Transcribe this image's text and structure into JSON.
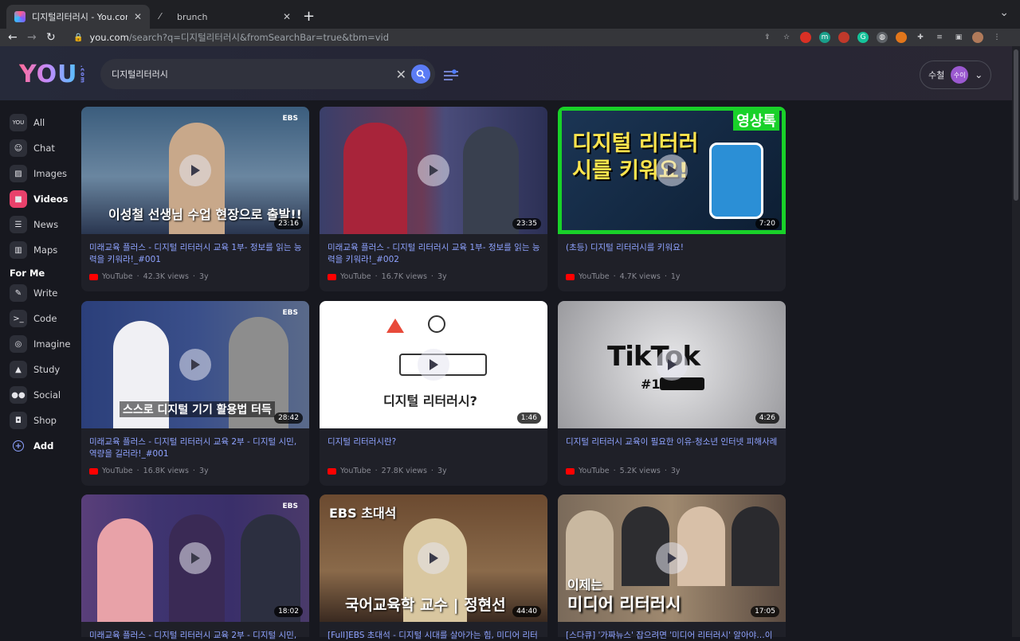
{
  "browser": {
    "tabs": [
      {
        "title": "디지털리터러시 - You.com | The A",
        "active": true
      },
      {
        "title": "brunch",
        "active": false
      }
    ],
    "url_host": "you.com",
    "url_path": "/search?q=디지털리터러시&fromSearchBar=true&tbm=vid"
  },
  "app": {
    "logo": "YOU",
    "logo_suffix": ".com",
    "search_query": "디지털리터러시",
    "user_name": "수철",
    "avatar_text": "수이"
  },
  "sidebar": {
    "items": [
      {
        "label": "All",
        "icon": "you-icon"
      },
      {
        "label": "Chat",
        "icon": "chat-icon"
      },
      {
        "label": "Images",
        "icon": "image-icon"
      },
      {
        "label": "Videos",
        "icon": "video-icon",
        "active": true
      },
      {
        "label": "News",
        "icon": "news-icon"
      },
      {
        "label": "Maps",
        "icon": "map-icon"
      }
    ],
    "section_label": "For Me",
    "me_items": [
      {
        "label": "Write",
        "icon": "pencil-icon"
      },
      {
        "label": "Code",
        "icon": "terminal-icon"
      },
      {
        "label": "Imagine",
        "icon": "spiral-icon"
      },
      {
        "label": "Study",
        "icon": "graduation-cap-icon"
      },
      {
        "label": "Social",
        "icon": "people-icon"
      },
      {
        "label": "Shop",
        "icon": "bag-icon"
      }
    ],
    "add_label": "Add"
  },
  "videos": [
    {
      "title": "미래교육 플러스 - 디지털 리터러시 교육 1부- 정보를 읽는 능력을 키워라!_#001",
      "source": "YouTube",
      "views": "42.3K views",
      "age": "3y",
      "duration": "23:16",
      "thumb_caption": "이성철 선생님 수업 현장으로 출발!!",
      "thumb_badge": "EBS"
    },
    {
      "title": "미래교육 플러스 - 디지털 리터러시 교육 1부- 정보를 읽는 능력을 키워라!_#002",
      "source": "YouTube",
      "views": "16.7K views",
      "age": "3y",
      "duration": "23:35",
      "thumb_caption": "",
      "thumb_badge": ""
    },
    {
      "title": "(초등) 디지털 리터러시를 키워요!",
      "source": "YouTube",
      "views": "4.7K views",
      "age": "1y",
      "duration": "7:20",
      "thumb_caption": "디지털 리터러시를 키워요!",
      "thumb_badge": "영상톡"
    },
    {
      "title": "미래교육 플러스 - 디지털 리터러시 교육 2부 - 디지털 시민, 역량을 길러라!_#001",
      "source": "YouTube",
      "views": "16.8K views",
      "age": "3y",
      "duration": "28:42",
      "thumb_caption": "스스로 디지털 기기 활용법 터득",
      "thumb_badge": "EBS"
    },
    {
      "title": "디지털 리터러시란?",
      "source": "YouTube",
      "views": "27.8K views",
      "age": "3y",
      "duration": "1:46",
      "thumb_caption": "디지털 리터러시?",
      "thumb_badge": ""
    },
    {
      "title": "디지털 리터러시 교육이 필요한 이유-청소년 인터넷 피해사례",
      "source": "YouTube",
      "views": "5.2K views",
      "age": "3y",
      "duration": "4:26",
      "thumb_caption": "TikTok",
      "thumb_badge": "#1"
    },
    {
      "title": "미래교육 플러스 - 디지털 리터러시 교육 2부 - 디지털 시민, 역량",
      "source": "YouTube",
      "views": "",
      "age": "",
      "duration": "18:02",
      "thumb_caption": "",
      "thumb_badge": "EBS"
    },
    {
      "title": "[Full]EBS 초대석 - 디지털 시대를 살아가는 힘, 미디어 리터러시-",
      "source": "YouTube",
      "views": "",
      "age": "",
      "duration": "44:40",
      "thumb_caption": "국어교육학 교수 | 정현선",
      "thumb_badge": "EBS 초대석"
    },
    {
      "title": "[스다큐] '가짜뉴스' 잡으려면 '미디어 리터러시' 알아야…이제는 미",
      "source": "YouTube",
      "views": "",
      "age": "",
      "duration": "17:05",
      "thumb_caption": "미디어 리터러시",
      "thumb_badge": "이제는"
    }
  ],
  "colors": {
    "accent": "#e9416b",
    "link": "#8ea2ff",
    "search_button": "#5b7cf5"
  }
}
